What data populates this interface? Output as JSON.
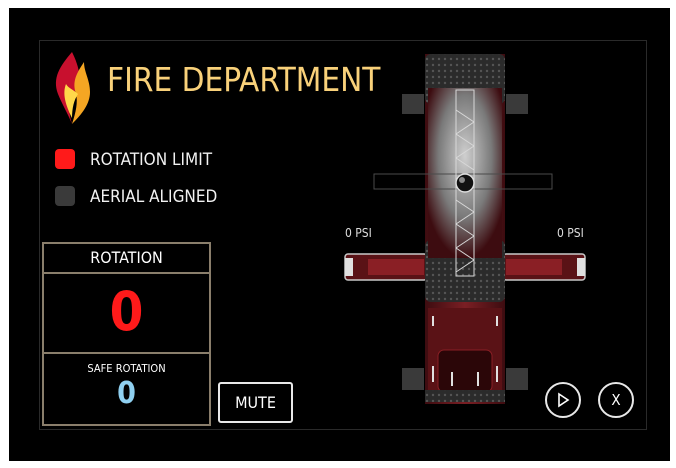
{
  "header": {
    "title": "FIRE DEPARTMENT"
  },
  "indicators": {
    "rotation_limit": {
      "label": "ROTATION LIMIT",
      "color": "#ff1a1a"
    },
    "aerial_aligned": {
      "label": "AERIAL ALIGNED",
      "color": "#3a3a3a"
    }
  },
  "rotation_panel": {
    "title": "ROTATION",
    "value": "0",
    "value_color": "#ff1a1a",
    "safe_label": "SAFE ROTATION",
    "safe_value": "0",
    "safe_color": "#8fd0f0"
  },
  "buttons": {
    "mute": "MUTE",
    "play_icon": "play-icon",
    "close_label": "X"
  },
  "outriggers": {
    "left_pressure": "0 PSI",
    "right_pressure": "0 PSI"
  },
  "colors": {
    "accent": "#f9d17a",
    "truck_body": "#6b1a1e",
    "frame_border": "#8a7e6b"
  }
}
